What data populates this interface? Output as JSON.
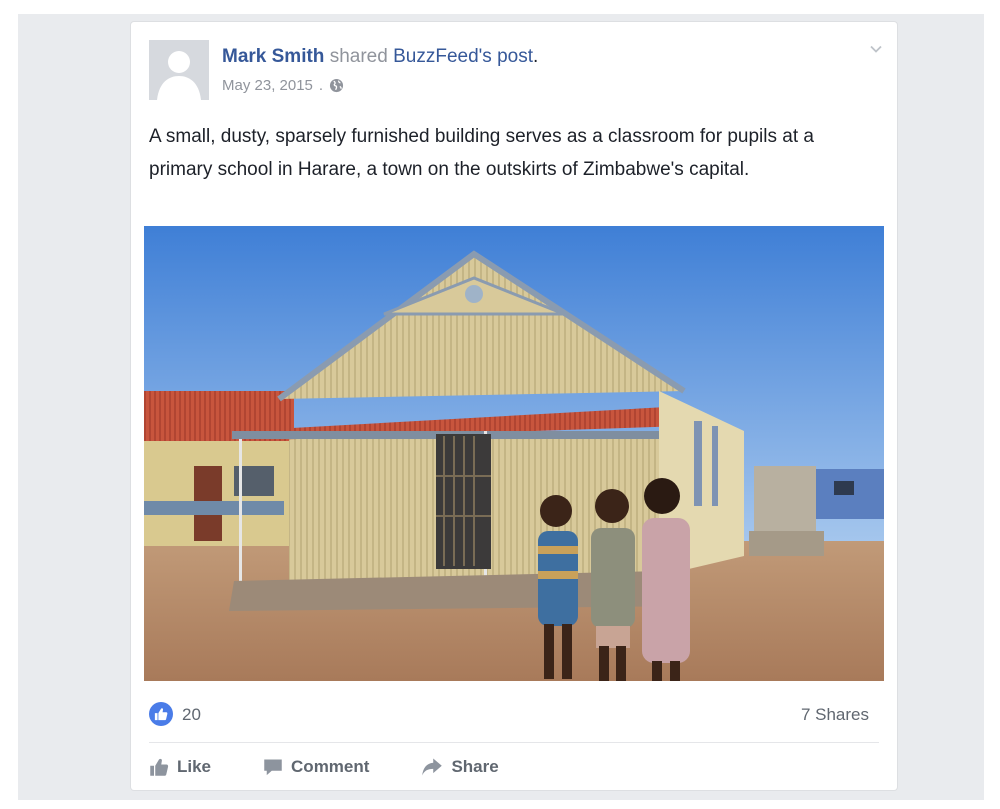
{
  "post": {
    "author": "Mark Smith",
    "shared_text": "shared",
    "source": "BuzzFeed",
    "possessive": "'s",
    "post_word": "post",
    "period": ".",
    "date": "May 23, 2015",
    "date_separator": ".",
    "privacy_icon": "globe-icon",
    "body": "A small, dusty, sparsely furnished building serves as a classroom for pupils at a primary school in Harare, a town on the outskirts of Zimbabwe's capital."
  },
  "stats": {
    "like_icon": "thumbs-up-icon",
    "likes": "20",
    "shares": "7 Shares"
  },
  "actions": {
    "like": "Like",
    "comment": "Comment",
    "share": "Share"
  },
  "colors": {
    "link": "#365899",
    "like_badge": "#4a7ce8",
    "background": "#e9ebee"
  }
}
